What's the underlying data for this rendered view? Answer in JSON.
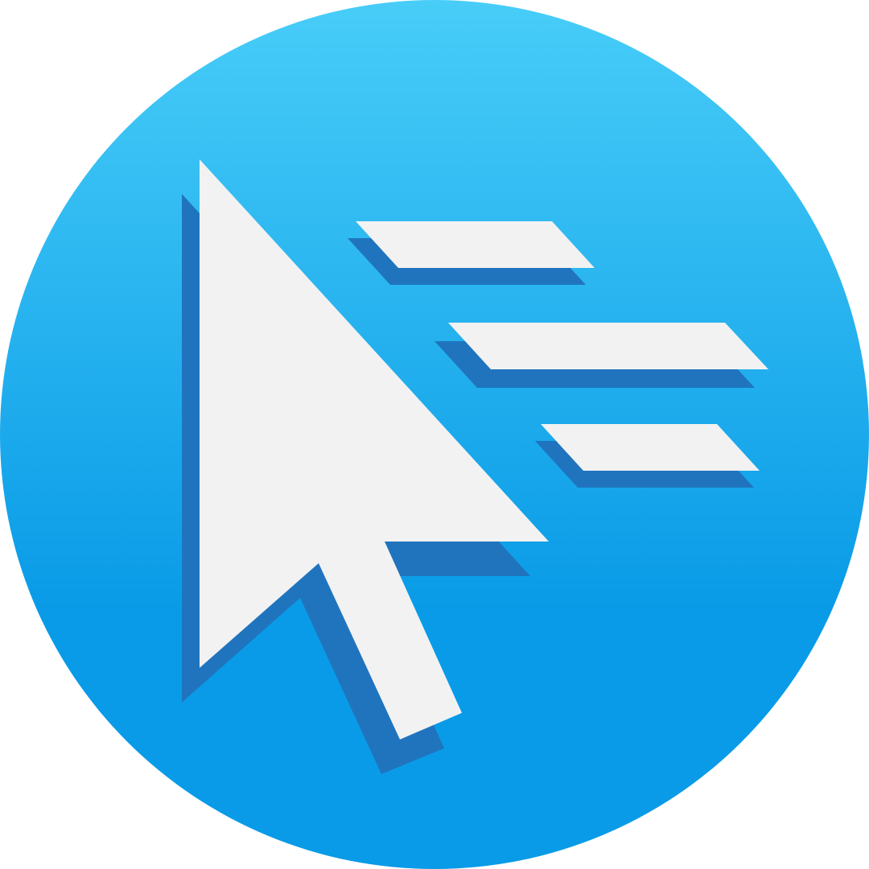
{
  "icon": {
    "name": "cursor-motion-app-icon",
    "colors": {
      "gradient_top": "#48CDF8",
      "gradient_bottom": "#099BE7",
      "shadow": "#2074BE",
      "glyph": "#F2F2F2"
    }
  }
}
